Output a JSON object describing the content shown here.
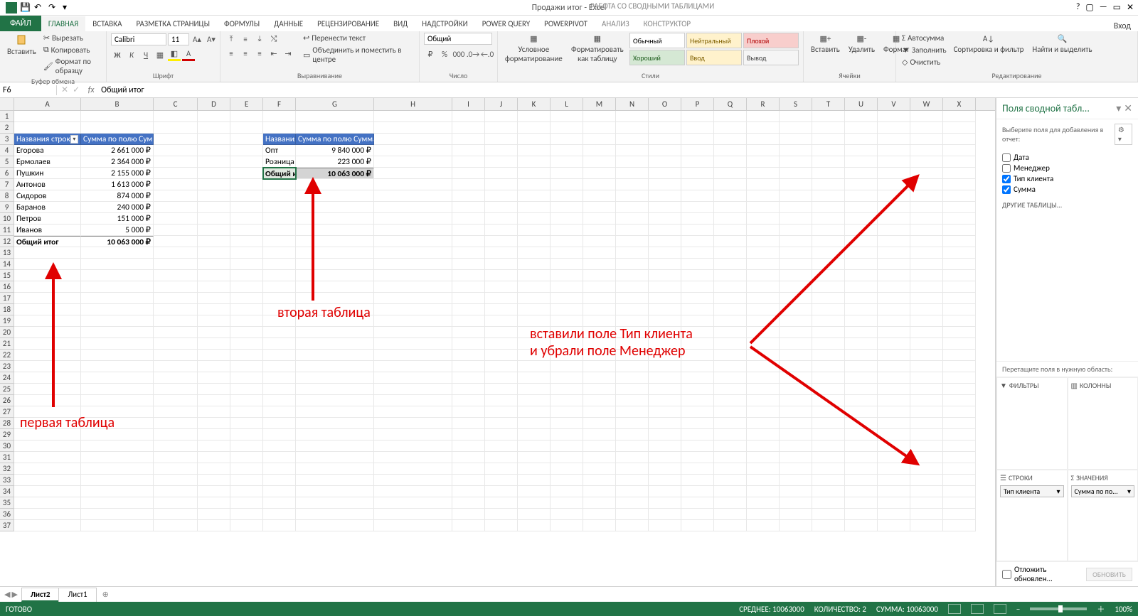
{
  "app": {
    "title": "Продажи итог - Excel",
    "context_title": "РАБОТА СО СВОДНЫМИ ТАБЛИЦАМИ",
    "login_hint": "Вход"
  },
  "tabs": {
    "file": "ФАЙЛ",
    "list": [
      "ГЛАВНАЯ",
      "ВСТАВКА",
      "РАЗМЕТКА СТРАНИЦЫ",
      "ФОРМУЛЫ",
      "ДАННЫЕ",
      "РЕЦЕНЗИРОВАНИЕ",
      "ВИД",
      "НАДСТРОЙКИ",
      "POWER QUERY",
      "POWERPIVOT",
      "АНАЛИЗ",
      "КОНСТРУКТОР"
    ],
    "active": 0,
    "context_start": 10
  },
  "ribbon": {
    "clipboard": {
      "label": "Буфер обмена",
      "paste": "Вставить",
      "cut": "Вырезать",
      "copy": "Копировать",
      "format_painter": "Формат по образцу"
    },
    "font": {
      "label": "Шрифт",
      "name": "Calibri",
      "size": "11"
    },
    "align": {
      "label": "Выравнивание",
      "wrap": "Перенести текст",
      "merge": "Объединить и поместить в центре"
    },
    "number": {
      "label": "Число",
      "format": "Общий"
    },
    "styles": {
      "label": "Стили",
      "cond": "Условное форматирование",
      "astable": "Форматировать как таблицу",
      "cells": [
        {
          "name": "Обычный",
          "bg": "#ffffff",
          "fg": "#000"
        },
        {
          "name": "Нейтральный",
          "bg": "#fff2cc",
          "fg": "#806000"
        },
        {
          "name": "Плохой",
          "bg": "#f8cecc",
          "fg": "#b00000"
        },
        {
          "name": "Хороший",
          "bg": "#d5e8d4",
          "fg": "#206020"
        },
        {
          "name": "Ввод",
          "bg": "#fff2cc",
          "fg": "#7f6000"
        },
        {
          "name": "Вывод",
          "bg": "#f5f5f5",
          "fg": "#404040"
        }
      ]
    },
    "cells": {
      "label": "Ячейки",
      "insert": "Вставить",
      "delete": "Удалить",
      "format": "Формат"
    },
    "editing": {
      "label": "Редактирование",
      "autosum": "Автосумма",
      "fill": "Заполнить",
      "clear": "Очистить",
      "sort": "Сортировка и фильтр",
      "find": "Найти и выделить"
    }
  },
  "fbar": {
    "namebox": "F6",
    "formula": "Общий итог"
  },
  "columns": {
    "widths": [
      94,
      102,
      62,
      46,
      46,
      46,
      110,
      110,
      46,
      46,
      46,
      46,
      46,
      46,
      46,
      46,
      46,
      46,
      46,
      46,
      46,
      46,
      46,
      46
    ],
    "letters": [
      "A",
      "B",
      "C",
      "D",
      "E",
      "F",
      "G",
      "H",
      "I",
      "J",
      "K",
      "L",
      "M",
      "N",
      "O",
      "P",
      "Q",
      "R",
      "S",
      "T",
      "U",
      "V",
      "W",
      "X"
    ]
  },
  "rows_count": 37,
  "pivot1": {
    "header": [
      "Названия строк",
      "Сумма по полю Сумма"
    ],
    "rows": [
      [
        "Егорова",
        "2 661 000 ₽"
      ],
      [
        "Ермолаев",
        "2 364 000 ₽"
      ],
      [
        "Пушкин",
        "2 155 000 ₽"
      ],
      [
        "Антонов",
        "1 613 000 ₽"
      ],
      [
        "Сидоров",
        "874 000 ₽"
      ],
      [
        "Баранов",
        "240 000 ₽"
      ],
      [
        "Петров",
        "151 000 ₽"
      ],
      [
        "Иванов",
        "5 000 ₽"
      ]
    ],
    "total": [
      "Общий итог",
      "10 063 000 ₽"
    ]
  },
  "pivot2": {
    "header": [
      "Названия строк",
      "Сумма по полю Сумма"
    ],
    "rows": [
      [
        "Опт",
        "9 840 000 ₽"
      ],
      [
        "Розница",
        "223 000 ₽"
      ]
    ],
    "total": [
      "Общий итог",
      "10 063 000 ₽"
    ]
  },
  "panel": {
    "title": "Поля сводной табл...",
    "subtitle": "Выберите поля для добавления в отчет:",
    "fields": [
      {
        "label": "Дата",
        "checked": false
      },
      {
        "label": "Менеджер",
        "checked": false
      },
      {
        "label": "Тип клиента",
        "checked": true
      },
      {
        "label": "Сумма",
        "checked": true
      }
    ],
    "more_tables": "ДРУГИЕ ТАБЛИЦЫ...",
    "drag_label": "Перетащите поля в нужную область:",
    "zones": {
      "filters": "ФИЛЬТРЫ",
      "columns": "КОЛОННЫ",
      "rows": "СТРОКИ",
      "values": "ЗНАЧЕНИЯ",
      "rows_pill": "Тип клиента",
      "values_pill": "Сумма по по..."
    },
    "defer": "Отложить обновлен...",
    "update": "ОБНОВИТЬ"
  },
  "sheets": {
    "list": [
      "Лист2",
      "Лист1"
    ],
    "active": 0
  },
  "status": {
    "ready": "ГОТОВО",
    "avg": "СРЕДНЕЕ: 10063000",
    "count": "КОЛИЧЕСТВО: 2",
    "sum": "СУММА: 10063000",
    "zoom": "100%"
  },
  "annotations": {
    "a1": "первая таблица",
    "a2": "вторая таблица",
    "a3_line1": "вставили поле Тип клиента",
    "a3_line2": "и убрали поле Менеджер"
  },
  "selection": {
    "row": 6,
    "cols": [
      "F",
      "G"
    ]
  }
}
